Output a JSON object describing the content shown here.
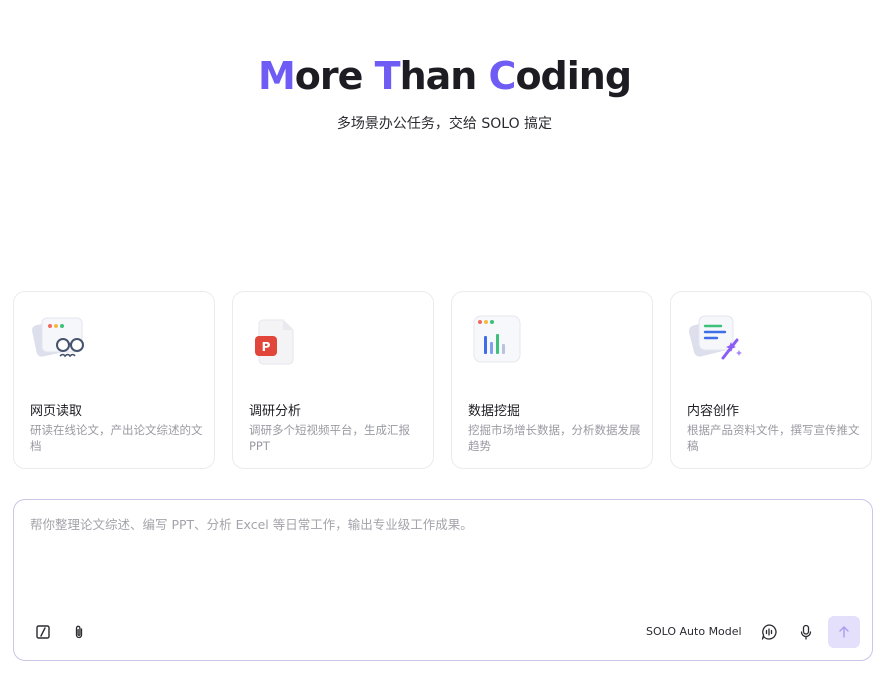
{
  "hero": {
    "title_parts": [
      {
        "text": "M",
        "accent": true
      },
      {
        "text": "ore ",
        "accent": false
      },
      {
        "text": "T",
        "accent": true
      },
      {
        "text": "han ",
        "accent": false
      },
      {
        "text": "C",
        "accent": true
      },
      {
        "text": "oding",
        "accent": false
      }
    ],
    "subtitle": "多场景办公任务，交给 SOLO 搞定"
  },
  "colors": {
    "accent": "#6f5cf5",
    "send_button_bg": "#e4e0fb",
    "input_border": "#c9c6e8"
  },
  "cards": [
    {
      "icon": "web-reading-glasses-icon",
      "title": "网页读取",
      "desc": "研读在线论文，产出论文综述的文档"
    },
    {
      "icon": "ppt-document-icon",
      "title": "调研分析",
      "desc": "调研多个短视频平台，生成汇报 PPT"
    },
    {
      "icon": "bar-chart-window-icon",
      "title": "数据挖掘",
      "desc": "挖掘市场增长数据，分析数据发展趋势"
    },
    {
      "icon": "sparkle-document-icon",
      "title": "内容创作",
      "desc": "根据产品资料文件，撰写宣传推文稿"
    }
  ],
  "composer": {
    "placeholder": "帮你整理论文综述、编写 PPT、分析 Excel 等日常工作，输出专业级工作成果。",
    "value": "",
    "model_label": "SOLO Auto Model",
    "icons": {
      "left": [
        "slash-command-icon",
        "paperclip-icon"
      ],
      "right": [
        "voice-chat-icon",
        "microphone-icon",
        "send-arrow-up-icon"
      ]
    }
  }
}
